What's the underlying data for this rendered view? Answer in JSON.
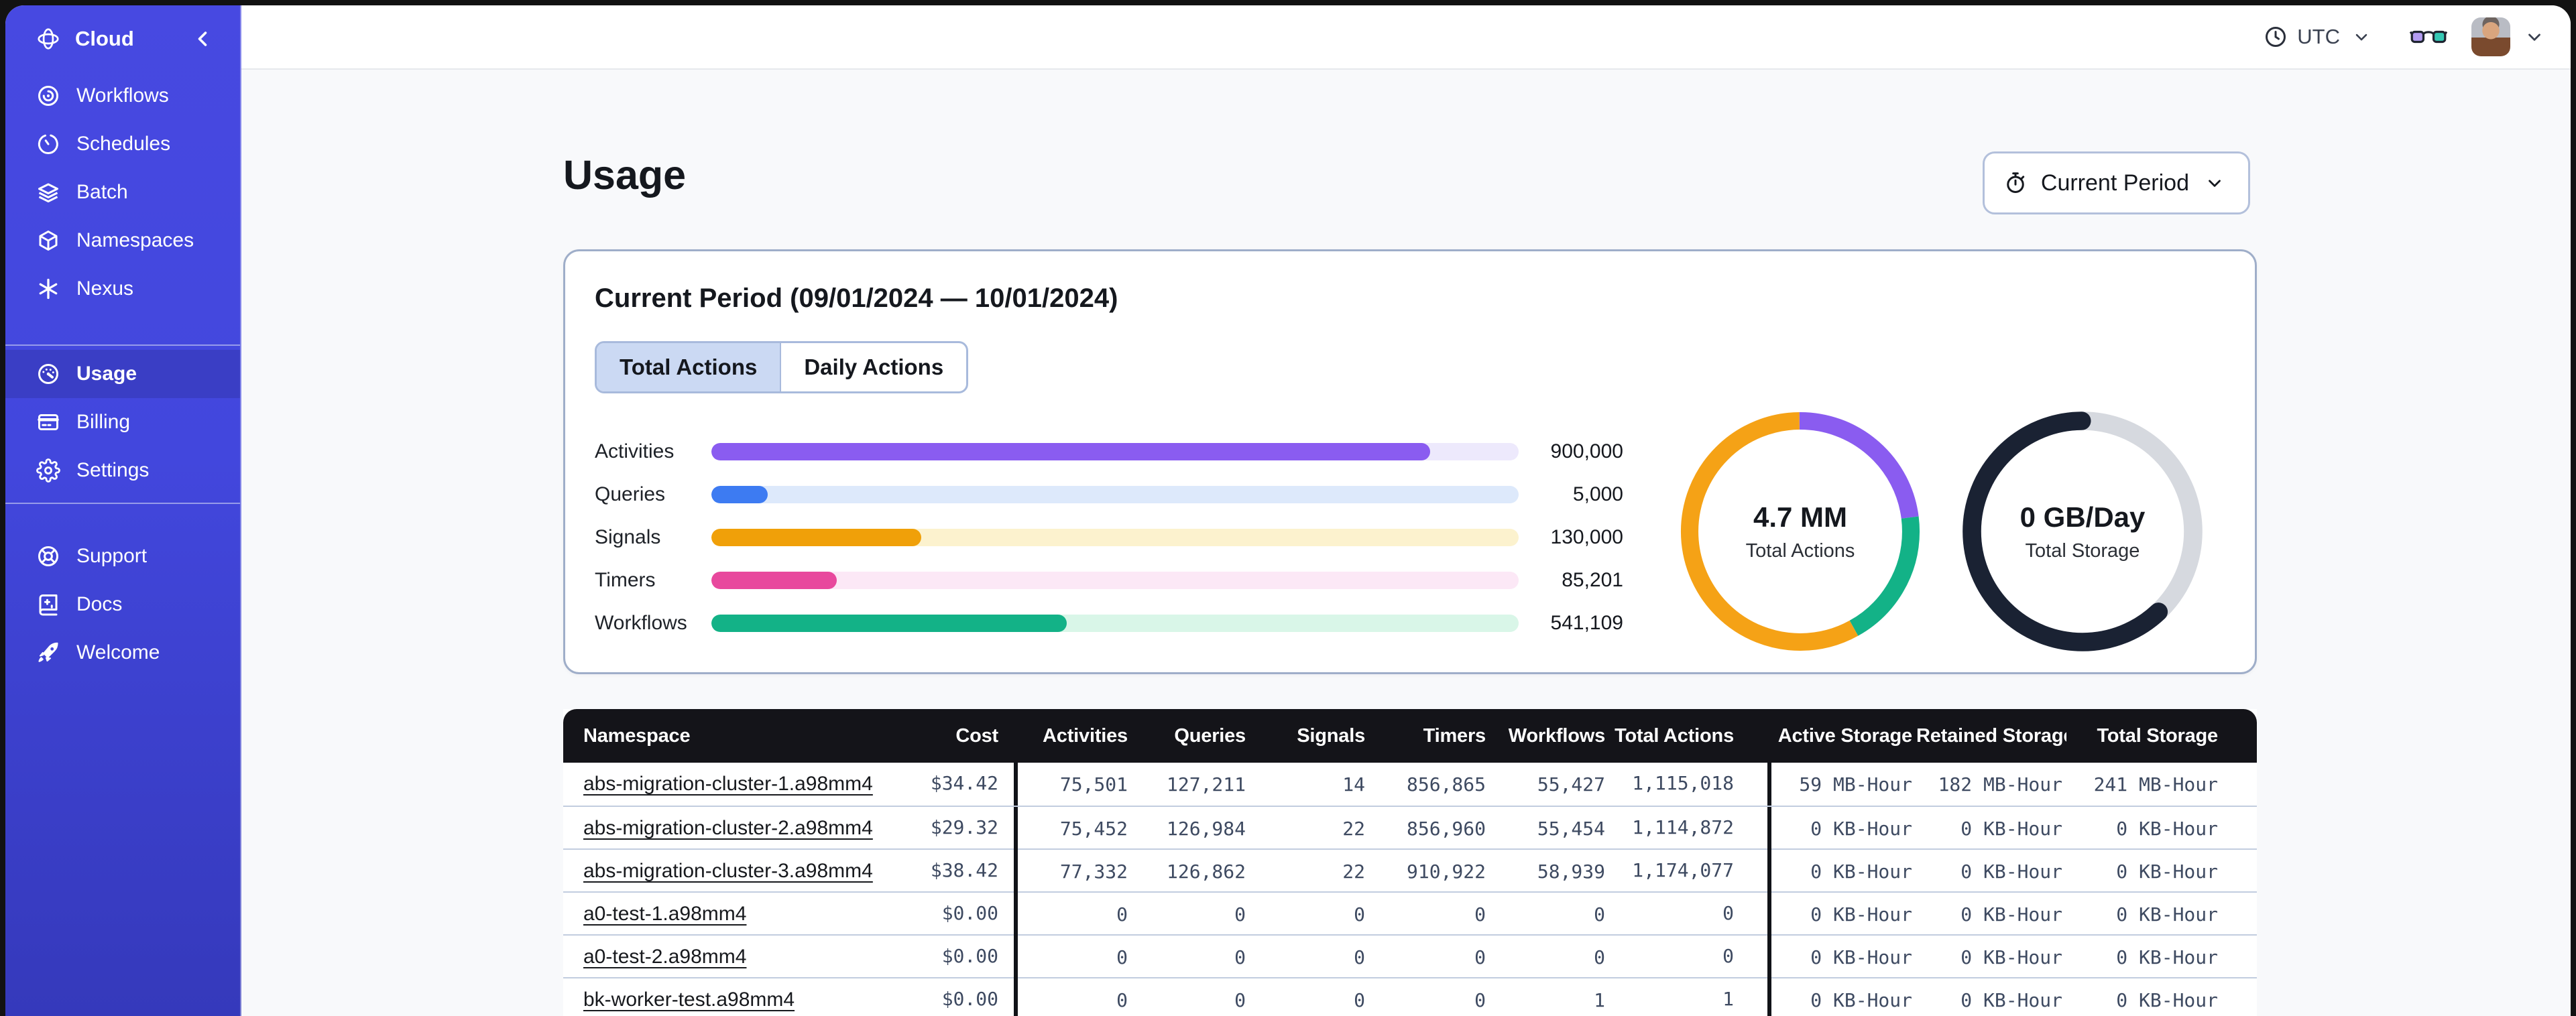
{
  "sidebar": {
    "brand": {
      "label": "Cloud",
      "icon": "temporal-orbit-icon",
      "collapse_icon": "chevron-left-icon"
    },
    "nav_main": [
      {
        "label": "Workflows",
        "icon": "workflows-icon"
      },
      {
        "label": "Schedules",
        "icon": "schedules-clock-icon"
      },
      {
        "label": "Batch",
        "icon": "batch-layers-icon"
      },
      {
        "label": "Namespaces",
        "icon": "namespaces-cube-icon"
      },
      {
        "label": "Nexus",
        "icon": "nexus-asterisk-icon"
      }
    ],
    "nav_account": [
      {
        "label": "Usage",
        "icon": "usage-gauge-icon",
        "active": true
      },
      {
        "label": "Billing",
        "icon": "billing-card-icon",
        "active": false
      },
      {
        "label": "Settings",
        "icon": "settings-gear-icon",
        "active": false
      }
    ],
    "nav_footer": [
      {
        "label": "Support",
        "icon": "support-lifebuoy-icon"
      },
      {
        "label": "Docs",
        "icon": "docs-book-icon"
      },
      {
        "label": "Welcome",
        "icon": "welcome-rocket-icon"
      }
    ],
    "colors": {
      "bg_top": "#4749E1",
      "bg_bottom": "#3539BB",
      "active_item_bg": "#3A3EC5"
    }
  },
  "topbar": {
    "timezone": {
      "label": "UTC",
      "icon": "clock-icon",
      "chevron": "chevron-down-icon"
    },
    "feedback_icon": "glasses-icon",
    "user_menu": {
      "avatar": "user-photo",
      "chevron": "chevron-down-icon"
    }
  },
  "page": {
    "title": "Usage",
    "period_selector": {
      "label": "Current Period",
      "icon": "stopwatch-icon",
      "chevron": "chevron-down-icon"
    }
  },
  "usage_card": {
    "title": "Current Period (09/01/2024 — 10/01/2024)",
    "tabs": [
      {
        "label": "Total Actions",
        "active": true
      },
      {
        "label": "Daily Actions",
        "active": false
      }
    ]
  },
  "chart_data": [
    {
      "type": "bar",
      "orientation": "horizontal",
      "categories": [
        "Activities",
        "Queries",
        "Signals",
        "Timers",
        "Workflows"
      ],
      "values": [
        900000,
        5000,
        130000,
        85201,
        541109
      ],
      "value_labels": [
        "900,000",
        "5,000",
        "130,000",
        "85,201",
        "541,109"
      ],
      "fill_pct": [
        89,
        7,
        26,
        15.5,
        44
      ],
      "colors": [
        "#8A5CF0",
        "#3D7BF2",
        "#F0A009",
        "#E8489D",
        "#13B287"
      ],
      "track_colors": [
        "#EDE9FC",
        "#DDE9FB",
        "#FCF2CE",
        "#FCE8F6",
        "#D9F6E8"
      ],
      "title": "",
      "xlabel": "",
      "ylabel": "",
      "grid": false,
      "legend": false
    },
    {
      "type": "donut",
      "center_value": "4.7 MM",
      "center_label": "Total Actions",
      "stroke_width": 8.7,
      "segments": [
        {
          "name": "activities",
          "color": "#8A5CF0",
          "start": 0,
          "pct": 23
        },
        {
          "name": "workflows",
          "color": "#13B287",
          "start": 23,
          "pct": 19
        },
        {
          "name": "other",
          "color": "#F5A216",
          "start": 42,
          "pct": 58
        }
      ]
    },
    {
      "type": "donut",
      "center_value": "0 GB/Day",
      "center_label": "Total Storage",
      "stroke_width": 9.2,
      "segments": [
        {
          "name": "track",
          "color": "#D6D9DF",
          "start": 0,
          "pct": 100
        },
        {
          "name": "used",
          "color": "#1A2233",
          "start": 38,
          "pct": 62,
          "linecap": "round"
        }
      ]
    }
  ],
  "table": {
    "headers": [
      "Namespace",
      "Cost",
      "Activities",
      "Queries",
      "Signals",
      "Timers",
      "Workflows",
      "Total Actions",
      "Active Storage",
      "Retained Storage",
      "Total Storage"
    ],
    "rows": [
      {
        "namespace": "abs-migration-cluster-1.a98mm4",
        "cells": [
          "$34.42",
          "75,501",
          "127,211",
          "14",
          "856,865",
          "55,427",
          "1,115,018",
          "59 MB-Hour",
          "182 MB-Hour",
          "241 MB-Hour"
        ]
      },
      {
        "namespace": "abs-migration-cluster-2.a98mm4",
        "cells": [
          "$29.32",
          "75,452",
          "126,984",
          "22",
          "856,960",
          "55,454",
          "1,114,872",
          "0 KB-Hour",
          "0 KB-Hour",
          "0 KB-Hour"
        ]
      },
      {
        "namespace": "abs-migration-cluster-3.a98mm4",
        "cells": [
          "$38.42",
          "77,332",
          "126,862",
          "22",
          "910,922",
          "58,939",
          "1,174,077",
          "0 KB-Hour",
          "0 KB-Hour",
          "0 KB-Hour"
        ]
      },
      {
        "namespace": "a0-test-1.a98mm4",
        "cells": [
          "$0.00",
          "0",
          "0",
          "0",
          "0",
          "0",
          "0",
          "0 KB-Hour",
          "0 KB-Hour",
          "0 KB-Hour"
        ]
      },
      {
        "namespace": "a0-test-2.a98mm4",
        "cells": [
          "$0.00",
          "0",
          "0",
          "0",
          "0",
          "0",
          "0",
          "0 KB-Hour",
          "0 KB-Hour",
          "0 KB-Hour"
        ]
      },
      {
        "namespace": "bk-worker-test.a98mm4",
        "cells": [
          "$0.00",
          "0",
          "0",
          "0",
          "0",
          "1",
          "1",
          "0 KB-Hour",
          "0 KB-Hour",
          "0 KB-Hour"
        ]
      }
    ]
  }
}
